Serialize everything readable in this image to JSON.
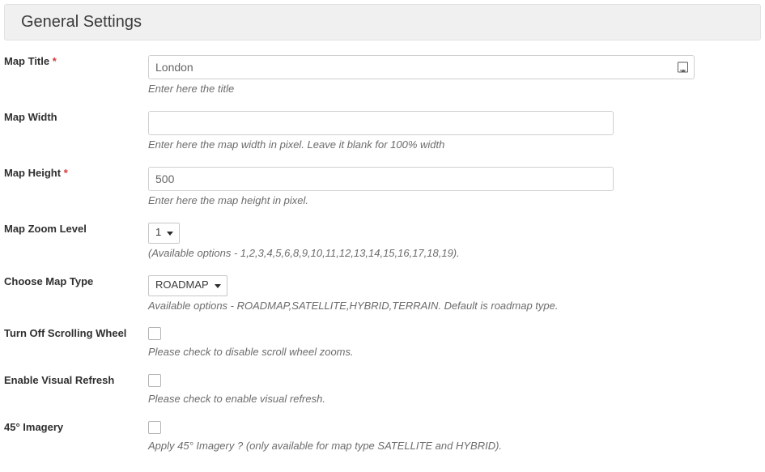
{
  "panel": {
    "title": "General Settings"
  },
  "fields": {
    "mapTitle": {
      "label": "Map Title",
      "required": "*",
      "value": "London",
      "help": "Enter here the title"
    },
    "mapWidth": {
      "label": "Map Width",
      "value": "",
      "help": "Enter here the map width in pixel. Leave it blank for 100% width"
    },
    "mapHeight": {
      "label": "Map Height",
      "required": "*",
      "value": "500",
      "help": "Enter here the map height in pixel."
    },
    "zoomLevel": {
      "label": "Map Zoom Level",
      "value": "1",
      "help": "(Available options - 1,2,3,4,5,6,8,9,10,11,12,13,14,15,16,17,18,19)."
    },
    "mapType": {
      "label": "Choose Map Type",
      "value": "ROADMAP",
      "help": "Available options - ROADMAP,SATELLITE,HYBRID,TERRAIN. Default is roadmap type."
    },
    "scrollWheel": {
      "label": "Turn Off Scrolling Wheel",
      "help": "Please check to disable scroll wheel zooms."
    },
    "visualRefresh": {
      "label": "Enable Visual Refresh",
      "help": "Please check to enable visual refresh."
    },
    "imagery45": {
      "label": "45° Imagery",
      "help": "Apply 45° Imagery ? (only available for map type SATELLITE and HYBRID)."
    }
  }
}
